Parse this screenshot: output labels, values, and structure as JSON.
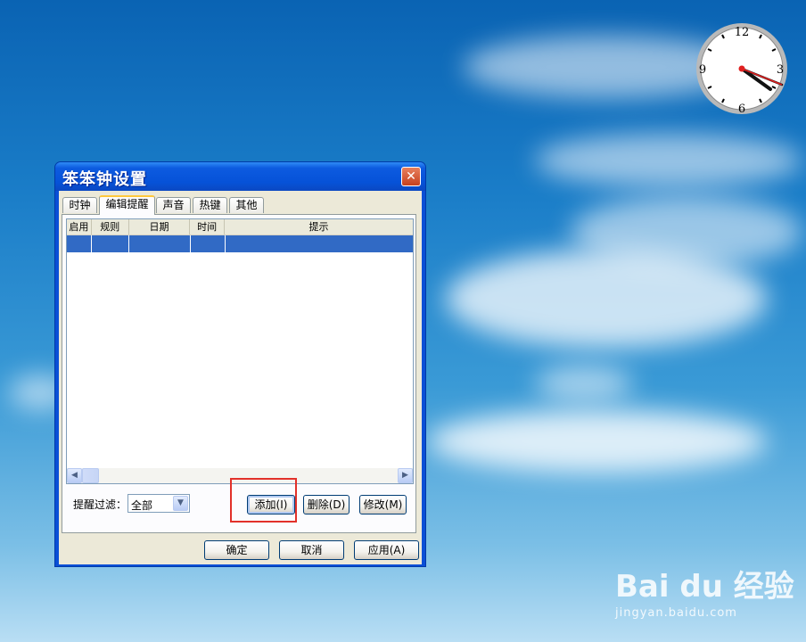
{
  "window": {
    "title": "笨笨钟设置",
    "close_glyph": "✕"
  },
  "tabs": [
    {
      "label": "时钟"
    },
    {
      "label": "编辑提醒"
    },
    {
      "label": "声音"
    },
    {
      "label": "热键"
    },
    {
      "label": "其他"
    }
  ],
  "table": {
    "columns": [
      "启用",
      "规则",
      "日期",
      "时间",
      "提示"
    ],
    "rows": [
      [
        "",
        "",
        "",
        "",
        ""
      ]
    ]
  },
  "filter": {
    "label": "提醒过滤：",
    "value": "全部"
  },
  "actions": {
    "add": "添加(I)",
    "delete": "删除(D)",
    "modify": "修改(M)"
  },
  "footer": {
    "ok": "确定",
    "cancel": "取消",
    "apply": "应用(A)"
  },
  "clock": {
    "n12": "12",
    "n3": "3",
    "n6": "6",
    "n9": "9"
  },
  "watermark": {
    "logo": "Bai du 经验",
    "sub": "jingyan.baidu.com"
  },
  "colors": {
    "title_bar": "#0652d8",
    "selection": "#316ac5",
    "highlight_box": "#e2312a"
  }
}
